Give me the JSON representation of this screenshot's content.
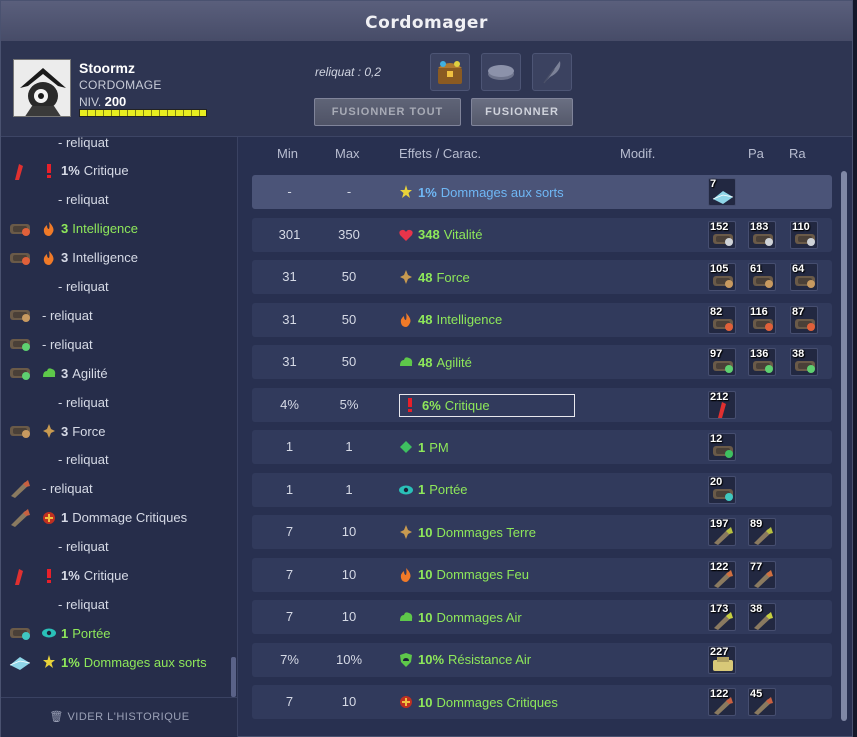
{
  "window": {
    "title": "Cordomager"
  },
  "player": {
    "name": "Stoormz",
    "job": "CORDOMAGE",
    "level_label": "NIV.",
    "level": "200",
    "xp_fraction": 1.0
  },
  "header": {
    "reliquat": "reliquat : 0,2",
    "fuse_all": "FUSIONNER TOUT",
    "fuse": "FUSIONNER"
  },
  "slots": [
    "chest-icon",
    "rune-slot-icon",
    "feather-icon"
  ],
  "columns": {
    "min": "Min",
    "max": "Max",
    "effects": "Effets / Carac.",
    "modif": "Modif.",
    "pa": "Pa",
    "ra": "Ra"
  },
  "history": {
    "clear": "VIDER L'HISTORIQUE",
    "items": [
      {
        "sub": true,
        "text": "- reliquat",
        "green": false
      },
      {
        "sub": false,
        "icon": "rune-crit-icon",
        "eic": "crit",
        "val": "1%",
        "text": "Critique",
        "green": false
      },
      {
        "sub": true,
        "text": "- reliquat",
        "green": false
      },
      {
        "sub": false,
        "icon": "rune-int-icon",
        "eic": "int",
        "val": "3",
        "text": "Intelligence",
        "green": true
      },
      {
        "sub": false,
        "icon": "rune-int-icon",
        "eic": "int",
        "val": "3",
        "text": "Intelligence",
        "green": false
      },
      {
        "sub": true,
        "text": "- reliquat",
        "green": false
      },
      {
        "sub": false,
        "icon": "rune-force-icon",
        "eic": "",
        "val": "",
        "text": "- reliquat",
        "green": false
      },
      {
        "sub": false,
        "icon": "rune-agi-icon",
        "eic": "",
        "val": "",
        "text": "- reliquat",
        "green": false
      },
      {
        "sub": false,
        "icon": "rune-agi-icon",
        "eic": "agi",
        "val": "3",
        "text": "Agilité",
        "green": false
      },
      {
        "sub": true,
        "text": "- reliquat",
        "green": false
      },
      {
        "sub": false,
        "icon": "rune-force-icon",
        "eic": "force",
        "val": "3",
        "text": "Force",
        "green": false
      },
      {
        "sub": true,
        "text": "- reliquat",
        "green": false
      },
      {
        "sub": false,
        "icon": "rune-dmg-icon",
        "eic": "",
        "val": "",
        "text": "- reliquat",
        "green": false
      },
      {
        "sub": false,
        "icon": "rune-dmg-icon",
        "eic": "dcrit",
        "val": "1",
        "text": "Dommage Critiques",
        "green": false
      },
      {
        "sub": true,
        "text": "- reliquat",
        "green": false
      },
      {
        "sub": false,
        "icon": "rune-crit-icon",
        "eic": "crit",
        "val": "1%",
        "text": "Critique",
        "green": false
      },
      {
        "sub": true,
        "text": "- reliquat",
        "green": false
      },
      {
        "sub": false,
        "icon": "rune-po-icon",
        "eic": "po",
        "val": "1",
        "text": "Portée",
        "green": true
      },
      {
        "sub": false,
        "icon": "rune-spell-icon",
        "eic": "spell",
        "val": "1%",
        "text": "Dommages aux sorts",
        "green": true
      }
    ]
  },
  "rows": [
    {
      "min": "-",
      "max": "-",
      "eic": "spell",
      "val": "1%",
      "text": "Dommages aux sorts",
      "style": "blue",
      "hl": true,
      "runes": [
        {
          "c": "7",
          "k": "spell",
          "col": "#8fd6e8"
        }
      ]
    },
    {
      "min": "301",
      "max": "350",
      "eic": "vit",
      "val": "348",
      "text": "Vitalité",
      "runes": [
        {
          "c": "152",
          "k": "vit",
          "col": "#cfd3d8"
        },
        {
          "c": "183",
          "k": "vit",
          "col": "#cfd3d8"
        },
        {
          "c": "110",
          "k": "vit",
          "col": "#cfd3d8"
        }
      ]
    },
    {
      "min": "31",
      "max": "50",
      "eic": "force",
      "val": "48",
      "text": "Force",
      "runes": [
        {
          "c": "105",
          "k": "force",
          "col": "#c89a60"
        },
        {
          "c": "61",
          "k": "force",
          "col": "#c89a60"
        },
        {
          "c": "64",
          "k": "force",
          "col": "#c89a60"
        }
      ]
    },
    {
      "min": "31",
      "max": "50",
      "eic": "int",
      "val": "48",
      "text": "Intelligence",
      "runes": [
        {
          "c": "82",
          "k": "int",
          "col": "#e0603a"
        },
        {
          "c": "116",
          "k": "int",
          "col": "#e0603a"
        },
        {
          "c": "87",
          "k": "int",
          "col": "#e0603a"
        }
      ]
    },
    {
      "min": "31",
      "max": "50",
      "eic": "agi",
      "val": "48",
      "text": "Agilité",
      "runes": [
        {
          "c": "97",
          "k": "agi",
          "col": "#5ed070"
        },
        {
          "c": "136",
          "k": "agi",
          "col": "#5ed070"
        },
        {
          "c": "38",
          "k": "agi",
          "col": "#5ed070"
        }
      ]
    },
    {
      "min": "4%",
      "max": "5%",
      "eic": "crit",
      "val": "6%",
      "text": "Critique",
      "style": "boxed",
      "runes": [
        {
          "c": "212",
          "k": "crit",
          "col": "#e03030"
        }
      ]
    },
    {
      "min": "1",
      "max": "1",
      "eic": "pm",
      "val": "1",
      "text": "PM",
      "runes": [
        {
          "c": "12",
          "k": "pm",
          "col": "#3ec060"
        }
      ]
    },
    {
      "min": "1",
      "max": "1",
      "eic": "po",
      "val": "1",
      "text": "Portée",
      "runes": [
        {
          "c": "20",
          "k": "po",
          "col": "#40c8c0"
        }
      ]
    },
    {
      "min": "7",
      "max": "10",
      "eic": "force",
      "val": "10",
      "text": "Dommages Terre",
      "runes": [
        {
          "c": "197",
          "k": "dmg",
          "col": "#b8c040"
        },
        {
          "c": "89",
          "k": "dmg",
          "col": "#b8c040"
        }
      ]
    },
    {
      "min": "7",
      "max": "10",
      "eic": "int",
      "val": "10",
      "text": "Dommages Feu",
      "runes": [
        {
          "c": "122",
          "k": "dmg",
          "col": "#d07040"
        },
        {
          "c": "77",
          "k": "dmg",
          "col": "#d07040"
        }
      ]
    },
    {
      "min": "7",
      "max": "10",
      "eic": "agi",
      "val": "10",
      "text": "Dommages Air",
      "runes": [
        {
          "c": "173",
          "k": "dmg",
          "col": "#c8d040"
        },
        {
          "c": "38",
          "k": "dmg",
          "col": "#c8d040"
        }
      ]
    },
    {
      "min": "7%",
      "max": "10%",
      "eic": "resair",
      "val": "10%",
      "text": "Résistance Air",
      "runes": [
        {
          "c": "227",
          "k": "res",
          "col": "#d8c878"
        }
      ]
    },
    {
      "min": "7",
      "max": "10",
      "eic": "dcrit",
      "val": "10",
      "text": "Dommages Critiques",
      "runes": [
        {
          "c": "122",
          "k": "dmg",
          "col": "#c86040"
        },
        {
          "c": "45",
          "k": "dmg",
          "col": "#c86040"
        }
      ]
    }
  ]
}
